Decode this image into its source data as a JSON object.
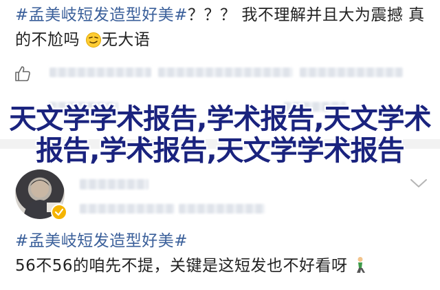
{
  "post": {
    "tag": "#孟美岐短发造型好美#",
    "body_line": "？？？ 我不理解并且大为震撼 真的不尬吗",
    "emoji_tail": "无大语"
  },
  "overlay": {
    "text": "天文学学术报告,学术报告,天文学术报告,学术报告,天文学学术报告"
  },
  "comment": {
    "tag": "#孟美岐短发造型好美#",
    "body": "56不56的咱先不提，关键是这短发也不好看呀"
  },
  "icons": [
    "like-icon",
    "chevron-down-icon",
    "verified-badge-icon",
    "emoji-icon",
    "kneeling-person-icon"
  ],
  "colors": {
    "tag": "#3a5f9a",
    "overlay": "#1a237e",
    "badge": "#f5b400"
  }
}
